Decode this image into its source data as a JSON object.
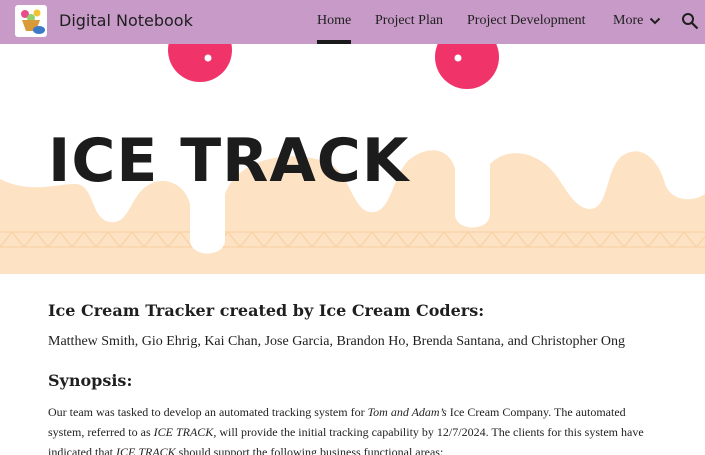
{
  "header": {
    "site_title": "Digital Notebook",
    "nav": [
      {
        "label": "Home",
        "active": true
      },
      {
        "label": "Project Plan",
        "active": false
      },
      {
        "label": "Project Development",
        "active": false
      },
      {
        "label": "More",
        "active": false
      }
    ],
    "more_icon": "chevron-down-icon",
    "search_icon": "search-icon",
    "bar_color": "#c79ac7"
  },
  "hero": {
    "title": "ICE TRACK",
    "colors": {
      "cream": "#fde3c4",
      "drip": "#ffffff",
      "sprinkle": "#f0346a"
    }
  },
  "content": {
    "heading_tracker": "Ice Cream Tracker created by Ice Cream Coders:",
    "team_names": "Matthew Smith, Gio Ehrig, Kai Chan, Jose Garcia, Brandon Ho, Brenda Santana, and Christopher Ong",
    "heading_synopsis": "Synopsis:",
    "synopsis": {
      "t1": "Our team was tasked to develop an automated tracking system for ",
      "t2": "Tom and Adam’s",
      "t3": " Ice Cream Company.  The automated system, referred to as ",
      "t4": "ICE TRACK,",
      "t5": " will provide the initial tracking capability by 12/7/2024. The clients for this system have indicated that ",
      "t6": "ICE TRACK",
      "t7": " should support the following business functional areas:"
    }
  }
}
